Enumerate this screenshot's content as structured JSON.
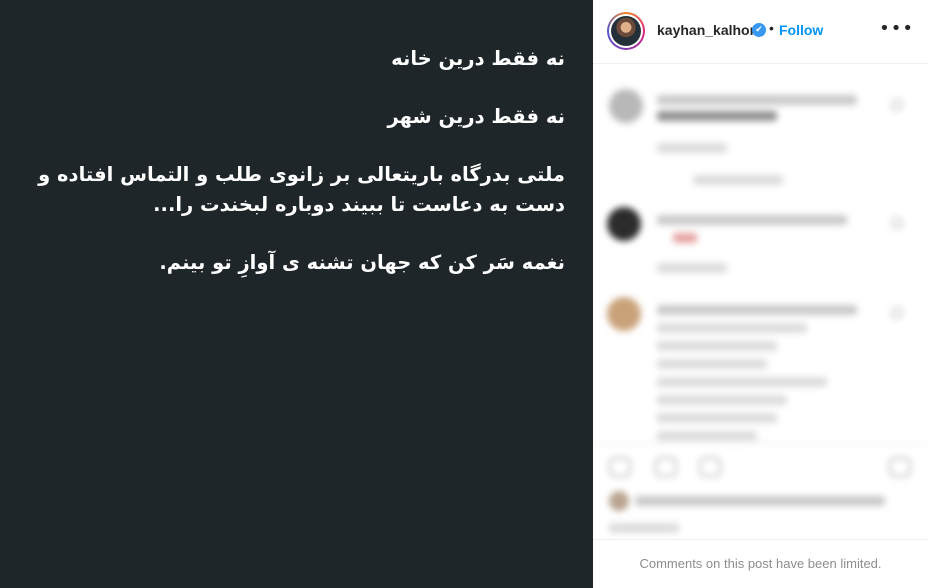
{
  "post": {
    "lines": [
      "نه فقط درین خانه",
      "نه فقط درین شهر",
      "ملتی بدرگاه باریتعالی بر زانوی طلب و التماس افتاده و\nدست به دعاست تا ببیند دوباره لبخندت را...",
      "نغمه سَر کن که جهان تشنه ی آوازِ تو بینم."
    ]
  },
  "header": {
    "username": "kayhan_kalhor",
    "verified_icon": "✔",
    "separator": "•",
    "follow_label": "Follow",
    "more_label": "•••"
  },
  "footer": {
    "limited_text": "Comments on this post have been limited."
  },
  "colors": {
    "post_background": "#1e2629",
    "follow": "#0095f6",
    "verified": "#3897f0"
  }
}
